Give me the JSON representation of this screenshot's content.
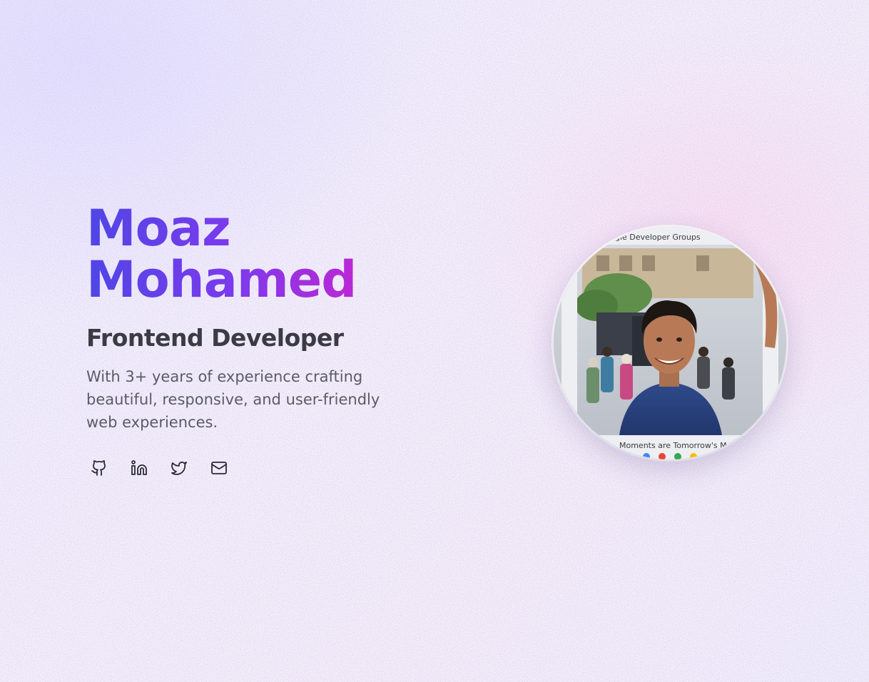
{
  "hero": {
    "first_name": "Moaz",
    "last_name": "Mohamed",
    "role": "Frontend Developer",
    "bio": "With 3+ years of experience crafting beautiful, responsive, and user-friendly web experiences."
  },
  "socials": [
    {
      "icon": "github-icon"
    },
    {
      "icon": "linkedin-icon"
    },
    {
      "icon": "twitter-icon"
    },
    {
      "icon": "mail-icon"
    }
  ],
  "avatar": {
    "frame_top_text": "gle Developer Groups",
    "frame_bottom_text": "Moments are Tomorrow's M"
  },
  "colors": {
    "name_gradient": [
      "#4f46e5",
      "#7c3aed",
      "#c026d3",
      "#db2777"
    ],
    "role": "#3b3b44",
    "bio": "#5b5b66",
    "icon": "#2a2a33"
  }
}
